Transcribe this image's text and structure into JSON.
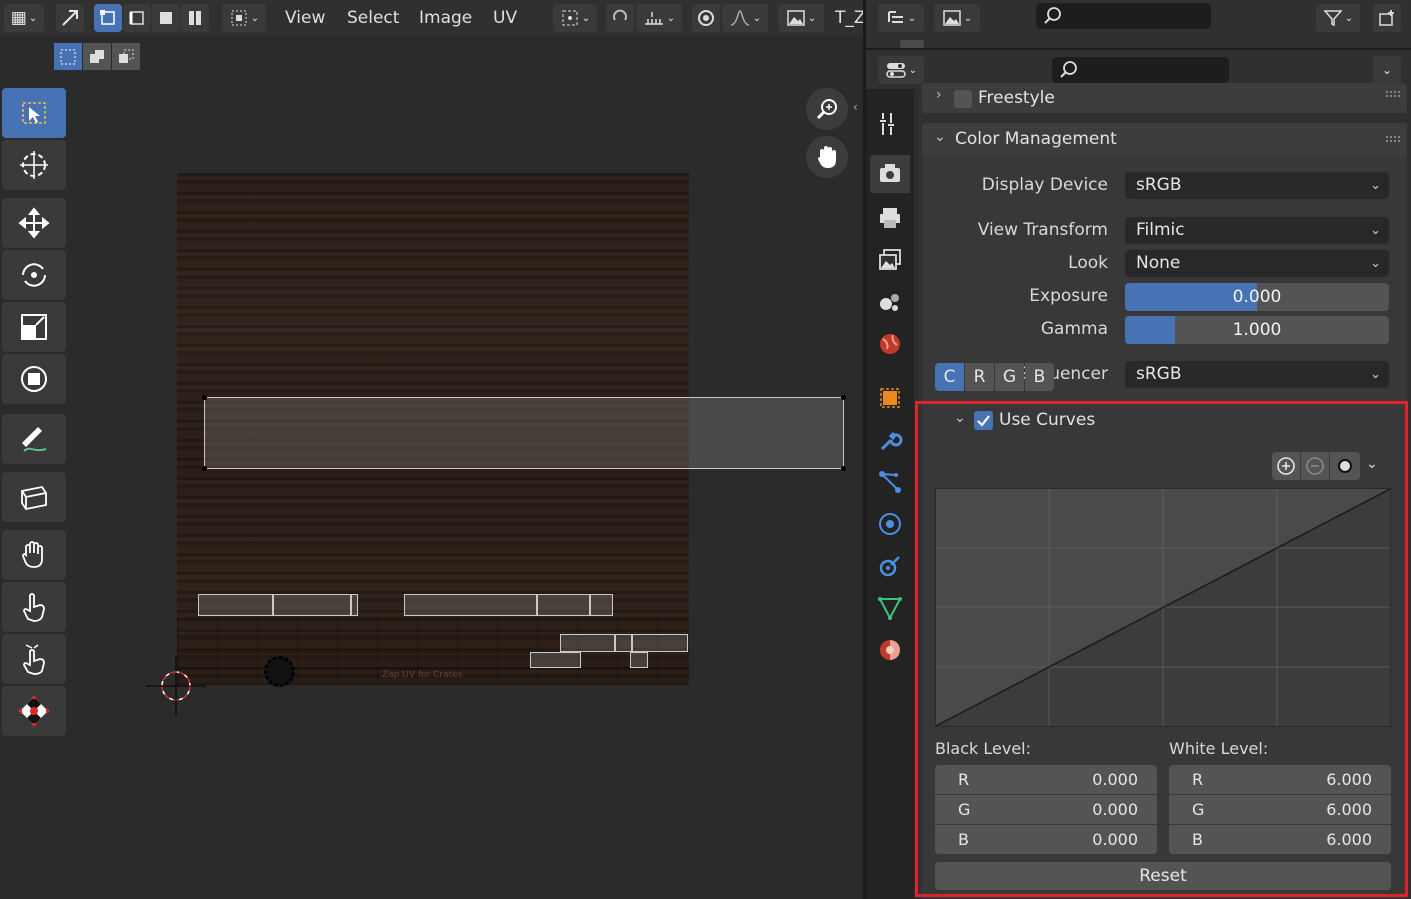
{
  "uv_header": {
    "menus": [
      "View",
      "Select",
      "Image",
      "UV"
    ],
    "truncated_label": "T_Z"
  },
  "tools": [
    {
      "name": "select-box"
    },
    {
      "name": "cursor"
    },
    {
      "name": "move"
    },
    {
      "name": "rotate"
    },
    {
      "name": "scale"
    },
    {
      "name": "transform"
    },
    {
      "name": "annotate"
    },
    {
      "name": "rip-region"
    },
    {
      "name": "grab"
    },
    {
      "name": "relax"
    },
    {
      "name": "pinch"
    },
    {
      "name": "sample"
    }
  ],
  "texture": {
    "caption": "Zap UV for Crates"
  },
  "properties": {
    "freestyle": {
      "label": "Freestyle"
    },
    "color_management": {
      "label": "Color Management",
      "display_device": {
        "label": "Display Device",
        "value": "sRGB"
      },
      "view_transform": {
        "label": "View Transform",
        "value": "Filmic"
      },
      "look": {
        "label": "Look",
        "value": "None"
      },
      "exposure": {
        "label": "Exposure",
        "value": "0.000",
        "fill": 0.5
      },
      "gamma": {
        "label": "Gamma",
        "value": "1.000",
        "fill": 0.19
      },
      "sequencer": {
        "label": "Sequencer",
        "value": "sRGB"
      }
    },
    "use_curves": {
      "label": "Use Curves",
      "checked": true,
      "channels": [
        "C",
        "R",
        "G",
        "B"
      ],
      "active_channel": "C",
      "black_level": {
        "label": "Black Level:",
        "rows": [
          {
            "k": "R",
            "v": "0.000"
          },
          {
            "k": "G",
            "v": "0.000"
          },
          {
            "k": "B",
            "v": "0.000"
          }
        ]
      },
      "white_level": {
        "label": "White Level:",
        "rows": [
          {
            "k": "R",
            "v": "6.000"
          },
          {
            "k": "G",
            "v": "6.000"
          },
          {
            "k": "B",
            "v": "6.000"
          }
        ]
      },
      "reset_label": "Reset"
    }
  },
  "colors": {
    "accent": "#4772b3",
    "highlight": "#e0222c"
  }
}
